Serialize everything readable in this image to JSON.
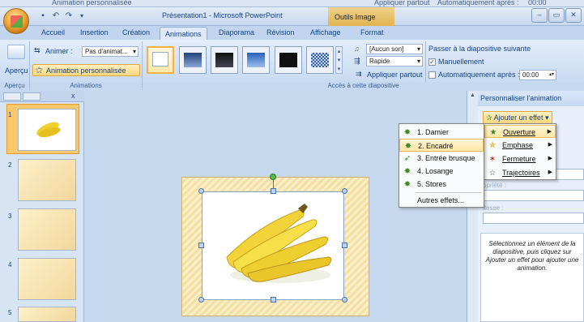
{
  "ghost_bar": {
    "anim_label": "Animation personnalisée",
    "apply_all": "Appliquer partout",
    "auto_after": "Automatiquement après :",
    "auto_value": "00:00"
  },
  "window": {
    "title": "Présentation1 - Microsoft PowerPoint",
    "context_tab": "Outils Image",
    "controls": [
      "–",
      "▭",
      "✕"
    ]
  },
  "tabs": [
    "Accueil",
    "Insertion",
    "Création",
    "Animations",
    "Diaporama",
    "Révision",
    "Affichage",
    "Format"
  ],
  "active_tab": "Animations",
  "ribbon": {
    "preview_label": "Aperçu",
    "animate_label": "Animer :",
    "animate_value": "Pas d'animat...",
    "custom_anim_button": "Animation personnalisée",
    "group_apercu": "Aperçu",
    "group_animations": "Animations",
    "group_transition": "Accès à cette diapositive",
    "sound_value": "[Aucun son]",
    "speed_value": "Rapide",
    "apply_all": "Appliquer partout",
    "advance_title": "Passer à la diapositive suivante",
    "manual_label": "Manuellement",
    "auto_label": "Automatiquement après :",
    "auto_value": "00:00"
  },
  "slide_numbers": [
    "1",
    "2",
    "3",
    "4",
    "5"
  ],
  "taskpane": {
    "title": "Personnaliser l'animation",
    "add_effect": "Ajouter un effet",
    "property_label": "opriété :",
    "speed_label": "itesse :",
    "message": "Sélectionnez un élément de la diapositive, puis cliquez sur Ajouter un effet pour ajouter une animation."
  },
  "effect_menu": [
    {
      "label": "Ouverture",
      "icon": "entrance-star-icon"
    },
    {
      "label": "Emphase",
      "icon": "emphasis-star-icon"
    },
    {
      "label": "Fermeture",
      "icon": "exit-star-icon"
    },
    {
      "label": "Trajectoires",
      "icon": "motion-path-icon"
    }
  ],
  "entrance_menu": [
    {
      "label": "1. Damier"
    },
    {
      "label": "2. Encadré"
    },
    {
      "label": "3. Entrée brusque"
    },
    {
      "label": "4. Losange"
    },
    {
      "label": "5. Stores"
    },
    {
      "label": "Autres effets..."
    }
  ],
  "colors": {
    "ribbon_bg": "#d0e0f4",
    "highlight": "#fde6a6",
    "accent_orange": "#f1b24b"
  }
}
